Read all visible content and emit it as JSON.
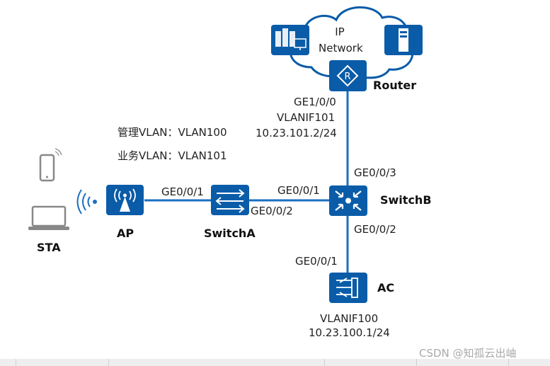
{
  "colors": {
    "device": "#0a5ca8",
    "link": "#1a6fc0",
    "text": "#222222"
  },
  "cloud": {
    "label_line1": "IP",
    "label_line2": "Network"
  },
  "nodes": {
    "router": {
      "name": "Router",
      "icon": "router-icon"
    },
    "switchb": {
      "name": "SwitchB",
      "icon": "core-switch-icon"
    },
    "switcha": {
      "name": "SwitchA",
      "icon": "switch-icon"
    },
    "ap": {
      "name": "AP",
      "icon": "access-point-icon"
    },
    "ac": {
      "name": "AC",
      "icon": "access-controller-icon"
    },
    "sta": {
      "name": "STA",
      "icon": "phone-laptop-icon"
    }
  },
  "labels": {
    "router_port": "GE1/0/0",
    "router_vlanif": "VLANIF101",
    "router_ip": "10.23.101.2/24",
    "mgmt_vlan": "管理VLAN：VLAN100",
    "service_vlan": "业务VLAN：VLAN101",
    "switchb_up": "GE0/0/3",
    "switchb_left": "GE0/0/1",
    "switchb_down": "GE0/0/2",
    "switcha_left": "GE0/0/1",
    "switcha_right": "GE0/0/2",
    "ac_port": "GE0/0/1",
    "ac_vlanif": "VLANIF100",
    "ac_ip": "10.23.100.1/24"
  },
  "watermark": "CSDN @知孤云出岫"
}
